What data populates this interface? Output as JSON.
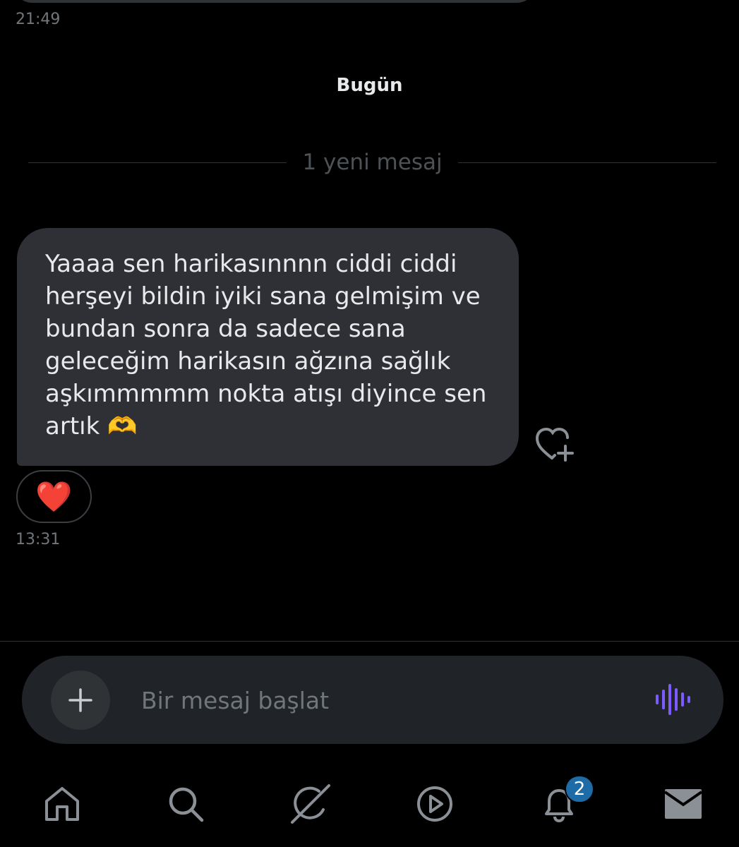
{
  "previous": {
    "time": "21:49"
  },
  "day_separator": "Bugün",
  "new_messages_label": "1 yeni mesaj",
  "message": {
    "text": "Yaaaa sen harikasınnnn ciddi ciddi\nherşeyi bildin iyiki sana gelmişim ve\nbundan sonra da sadece sana\ngeleceğim harikasın ağzına sağlık\naşkımmmmm nokta atışı diyince sen\nartık 🫶",
    "reaction": "❤️",
    "time": "13:31"
  },
  "composer": {
    "placeholder": "Bir mesaj başlat",
    "value": ""
  },
  "nav": {
    "items": [
      "home-icon",
      "search-icon",
      "grok-icon",
      "video-icon",
      "notifications-icon",
      "messages-icon"
    ],
    "notification_count": "2"
  },
  "colors": {
    "background": "#000000",
    "bubble": "#2f3036",
    "accent_voice": "#7c5cff",
    "badge": "#1d6ca8"
  }
}
